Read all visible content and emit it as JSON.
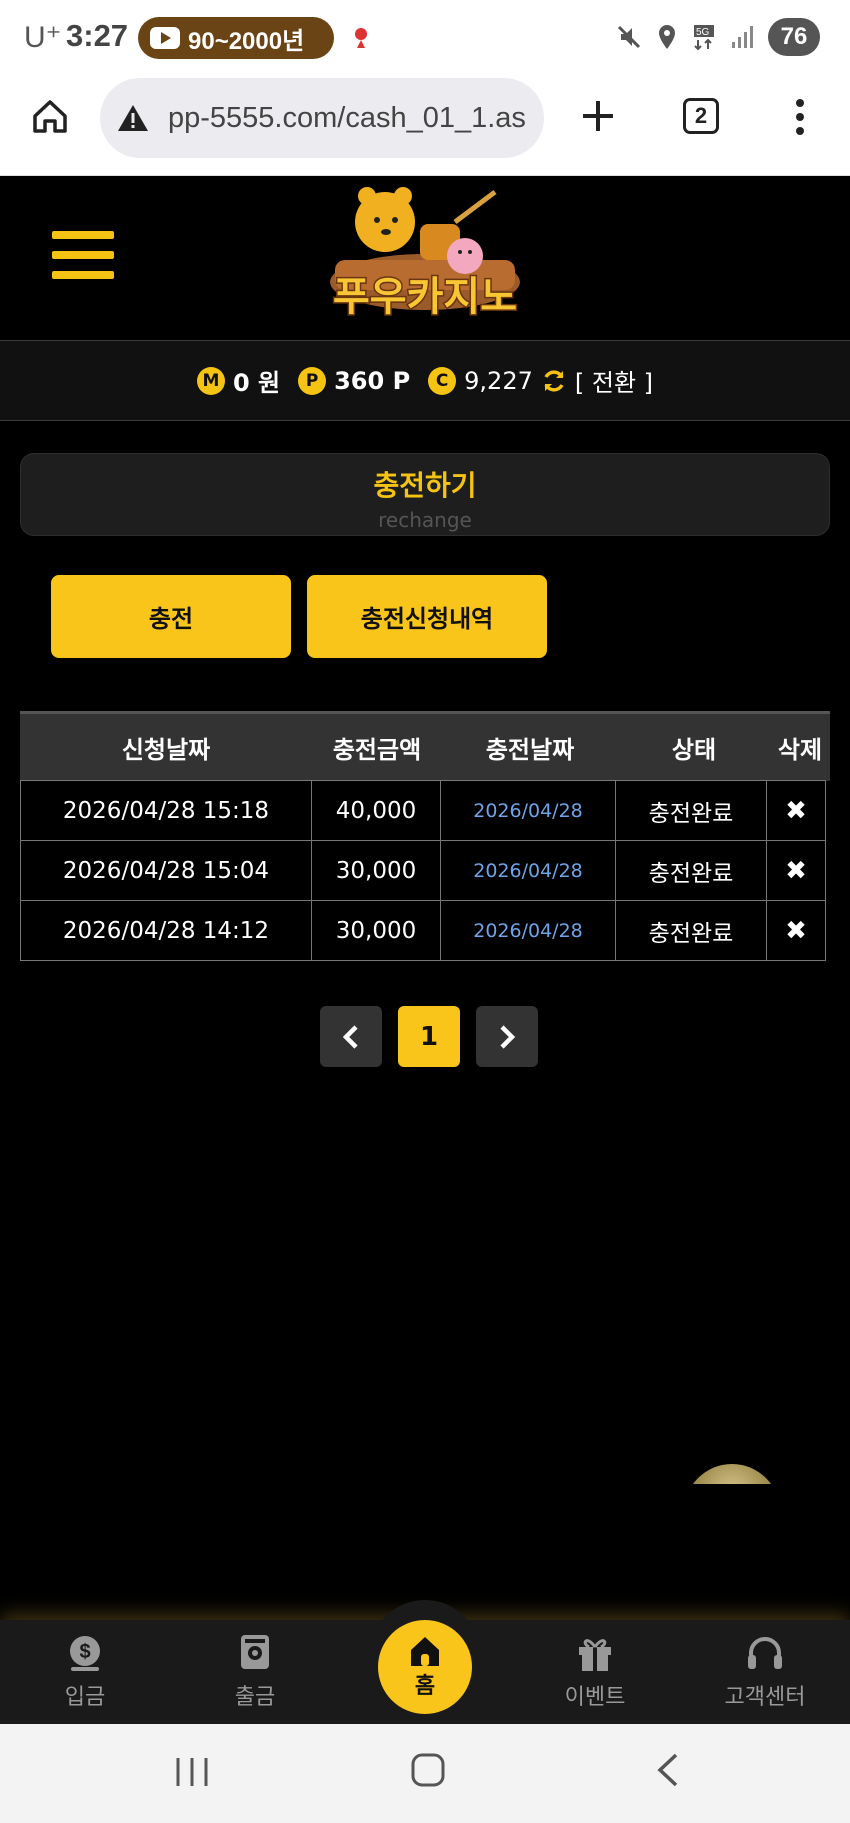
{
  "status_bar": {
    "carrier": "U⁺",
    "time": "3:27",
    "pill_text": "90~2000년",
    "battery": "76"
  },
  "browser": {
    "url": "pp-5555.com/cash_01_1.as",
    "tab_count": "2"
  },
  "site": {
    "logo_text": "푸우카지노"
  },
  "balance": {
    "money_icon": "M",
    "money": "0 원",
    "point_icon": "P",
    "points": "360 P",
    "casino_icon": "C",
    "casino": "9,227",
    "convert_label": "[ 전환 ]"
  },
  "section": {
    "title": "충전하기",
    "subtitle": "rechange"
  },
  "buttons": {
    "charge": "충전",
    "history": "충전신청내역"
  },
  "table": {
    "headers": [
      "신청날짜",
      "충전금액",
      "충전날짜",
      "상태",
      "삭제"
    ],
    "rows": [
      {
        "requested": "2026/04/28 15:18",
        "amount": "40,000",
        "charged": "2026/04/28",
        "status": "충전완료",
        "delete": "✖"
      },
      {
        "requested": "2026/04/28 15:04",
        "amount": "30,000",
        "charged": "2026/04/28",
        "status": "충전완료",
        "delete": "✖"
      },
      {
        "requested": "2026/04/28 14:12",
        "amount": "30,000",
        "charged": "2026/04/28",
        "status": "충전완료",
        "delete": "✖"
      }
    ]
  },
  "pagination": {
    "current": "1"
  },
  "bottom_nav": {
    "deposit": "입금",
    "withdraw": "출금",
    "home": "홈",
    "event": "이벤트",
    "support": "고객센터"
  },
  "colors": {
    "accent": "#f9c51a",
    "link": "#6ea4e8"
  }
}
